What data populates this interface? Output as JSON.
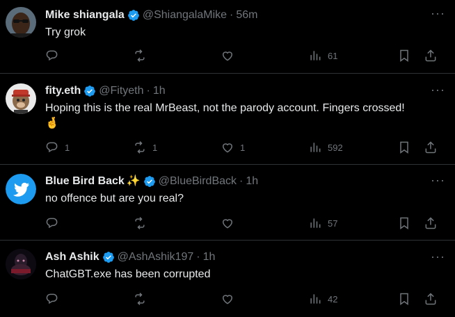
{
  "tweets": [
    {
      "name": "Mike shiangala",
      "handle": "@ShiangalaMike",
      "time": "56m",
      "text": "Try grok",
      "text2": "",
      "reply_count": "",
      "retweet_count": "",
      "like_count": "",
      "view_count": "61"
    },
    {
      "name": "fity.eth",
      "handle": "@Fityeth",
      "time": "1h",
      "text": "Hoping this is the real MrBeast, not the parody account. Fingers crossed!",
      "text2": "🤞",
      "reply_count": "1",
      "retweet_count": "1",
      "like_count": "1",
      "view_count": "592"
    },
    {
      "name": "Blue Bird Back",
      "name_emoji": "✨",
      "handle": "@BlueBirdBack",
      "time": "1h",
      "text": "no offence but are you real?",
      "text2": "",
      "reply_count": "",
      "retweet_count": "",
      "like_count": "",
      "view_count": "57"
    },
    {
      "name": "Ash Ashik",
      "handle": "@AshAshik197",
      "time": "1h",
      "text": "ChatGBT.exe has been corrupted",
      "text2": "",
      "reply_count": "",
      "retweet_count": "",
      "like_count": "",
      "view_count": "42"
    }
  ],
  "ui": {
    "separator": "·",
    "more_glyph": "···"
  },
  "colors": {
    "background": "#000000",
    "text": "#e7e9ea",
    "muted": "#71767b",
    "verified": "#1d9bf0",
    "border": "#2f3336"
  },
  "icons": [
    "verified-badge-icon",
    "more-icon",
    "reply-icon",
    "retweet-icon",
    "like-icon",
    "views-icon",
    "bookmark-icon",
    "share-icon"
  ]
}
